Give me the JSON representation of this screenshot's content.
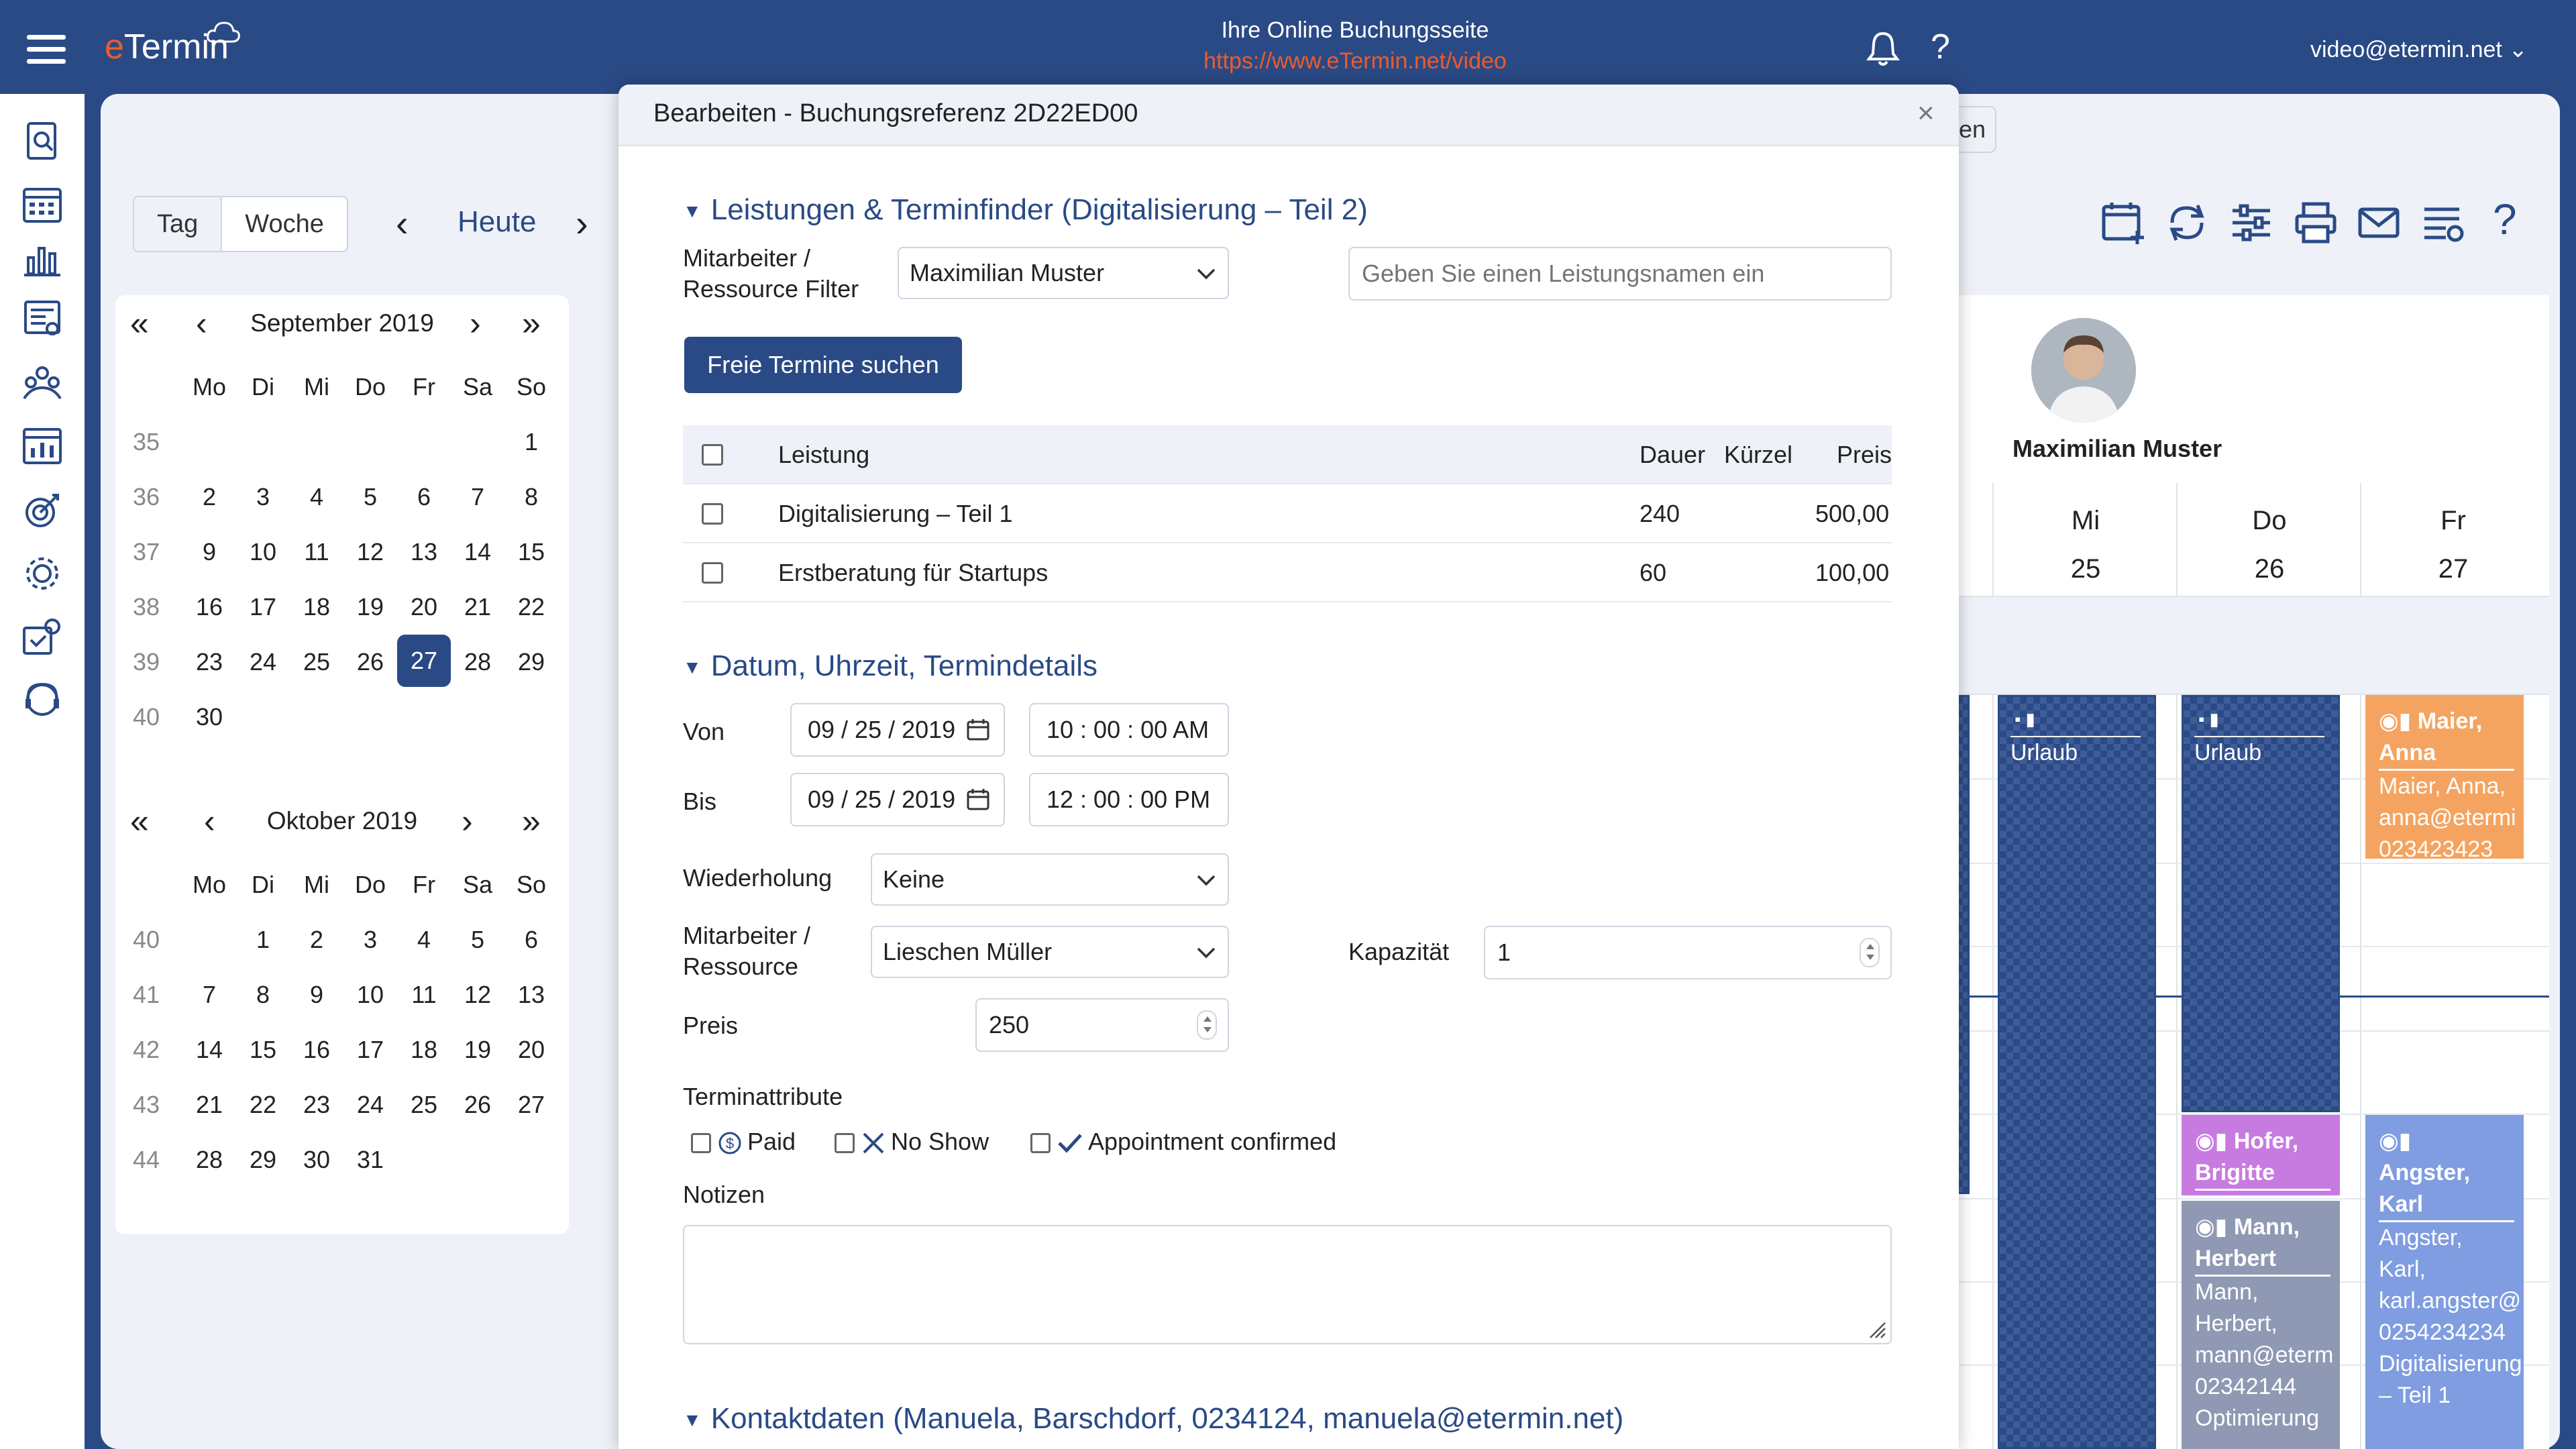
{
  "app": {
    "logo_e": "e",
    "logo_rest": "Termin",
    "site_title": "Ihre Online Buchungsseite",
    "site_url": "https://www.eTermin.net/video",
    "user_email": "video@etermin.net"
  },
  "toolbar": {
    "view_day": "Tag",
    "view_week": "Woche",
    "prev": "‹",
    "today": "Heute",
    "next": "›",
    "help": "?"
  },
  "mini_cal_1": {
    "month": "September 2019",
    "weekdays": [
      "Mo",
      "Di",
      "Mi",
      "Do",
      "Fr",
      "Sa",
      "So"
    ],
    "weeks": [
      {
        "wk": "35",
        "days": [
          "",
          "",
          "",
          "",
          "",
          "",
          "1"
        ]
      },
      {
        "wk": "36",
        "days": [
          "2",
          "3",
          "4",
          "5",
          "6",
          "7",
          "8"
        ]
      },
      {
        "wk": "37",
        "days": [
          "9",
          "10",
          "11",
          "12",
          "13",
          "14",
          "15"
        ]
      },
      {
        "wk": "38",
        "days": [
          "16",
          "17",
          "18",
          "19",
          "20",
          "21",
          "22"
        ]
      },
      {
        "wk": "39",
        "days": [
          "23",
          "24",
          "25",
          "26",
          "27",
          "28",
          "29"
        ]
      },
      {
        "wk": "40",
        "days": [
          "30",
          "",
          "",
          "",
          "",
          "",
          ""
        ]
      }
    ],
    "selected": "27"
  },
  "mini_cal_2": {
    "month": "Oktober 2019",
    "weekdays": [
      "Mo",
      "Di",
      "Mi",
      "Do",
      "Fr",
      "Sa",
      "So"
    ],
    "weeks": [
      {
        "wk": "40",
        "days": [
          "",
          "1",
          "2",
          "3",
          "4",
          "5",
          "6"
        ]
      },
      {
        "wk": "41",
        "days": [
          "7",
          "8",
          "9",
          "10",
          "11",
          "12",
          "13"
        ]
      },
      {
        "wk": "42",
        "days": [
          "14",
          "15",
          "16",
          "17",
          "18",
          "19",
          "20"
        ]
      },
      {
        "wk": "43",
        "days": [
          "21",
          "22",
          "23",
          "24",
          "25",
          "26",
          "27"
        ]
      },
      {
        "wk": "44",
        "days": [
          "28",
          "29",
          "30",
          "31",
          "",
          "",
          ""
        ]
      }
    ]
  },
  "week_view": {
    "staff_name": "Maximilian Muster",
    "days": [
      {
        "name": "Mi",
        "num": "25"
      },
      {
        "name": "Do",
        "num": "26"
      },
      {
        "name": "Fr",
        "num": "27"
      }
    ],
    "partial_button": "en",
    "blocks": {
      "urlaub_label": "Urlaub",
      "maier_title": "Maier, Anna",
      "maier_body": "Maier, Anna, anna@etermi 023423423",
      "hofer_title": "Hofer, Brigitte",
      "mann_title": "Mann, Herbert",
      "mann_body": "Mann, Herbert, mann@eterm 02342144 Optimierung",
      "angster_title": "Angster, Karl",
      "angster_body": "Angster, Karl, karl.angster@ 0254234234 Digitalisierung – Teil 1"
    },
    "colors": {
      "urlaub": "#2a4a86",
      "maier": "#f4a460",
      "hofer": "#c77be0",
      "mann": "#8f99b3",
      "angster": "#7f9de0"
    }
  },
  "modal": {
    "title": "Bearbeiten - Buchungsreferenz 2D22ED00",
    "close": "×",
    "section_services": "Leistungen & Terminfinder (Digitalisierung – Teil 2)",
    "staff_filter_label": "Mitarbeiter / Ressource Filter",
    "staff_filter_value": "Maximilian Muster",
    "service_search_placeholder": "Geben Sie einen Leistungsnamen ein",
    "search_button": "Freie Termine suchen",
    "table": {
      "headers": {
        "service": "Leistung",
        "duration": "Dauer",
        "short": "Kürzel",
        "price": "Preis"
      },
      "rows": [
        {
          "service": "Digitalisierung – Teil 1",
          "duration": "240",
          "short": "",
          "price": "500,00"
        },
        {
          "service": "Erstberatung für Startups",
          "duration": "60",
          "short": "",
          "price": "100,00"
        }
      ]
    },
    "section_datetime": "Datum, Uhrzeit, Termindetails",
    "from_label": "Von",
    "from_date": "09 / 25 / 2019",
    "from_time": "10 : 00 : 00   AM",
    "to_label": "Bis",
    "to_date": "09 / 25 / 2019",
    "to_time": "12 : 00 : 00   PM",
    "repeat_label": "Wiederholung",
    "repeat_value": "Keine",
    "staff_label": "Mitarbeiter / Ressource",
    "staff_value": "Lieschen Müller",
    "capacity_label": "Kapazität",
    "capacity_value": "1",
    "price_label": "Preis",
    "price_value": "250",
    "attributes_label": "Terminattribute",
    "attr_paid": "Paid",
    "attr_noshow": "No Show",
    "attr_confirmed": "Appointment confirmed",
    "notes_label": "Notizen",
    "section_contact": "Kontaktdaten (Manuela, Barschdorf, 0234124, manuela@etermin.net)"
  }
}
